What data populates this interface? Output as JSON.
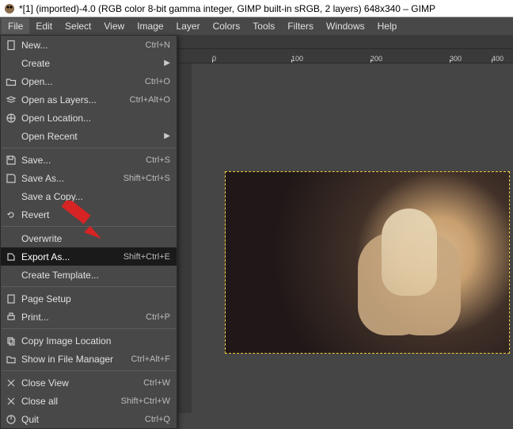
{
  "title": "*[1] (imported)-4.0 (RGB color 8-bit gamma integer, GIMP built-in sRGB, 2 layers) 648x340 – GIMP",
  "menubar": [
    "File",
    "Edit",
    "Select",
    "View",
    "Image",
    "Layer",
    "Colors",
    "Tools",
    "Filters",
    "Windows",
    "Help"
  ],
  "ruler_ticks": [
    "0",
    "100",
    "200",
    "300",
    "400"
  ],
  "file_menu": {
    "new": {
      "label": "New...",
      "accel": "Ctrl+N"
    },
    "create": {
      "label": "Create",
      "submenu": true
    },
    "open": {
      "label": "Open...",
      "accel": "Ctrl+O"
    },
    "open_layers": {
      "label": "Open as Layers...",
      "accel": "Ctrl+Alt+O"
    },
    "open_location": {
      "label": "Open Location..."
    },
    "open_recent": {
      "label": "Open Recent",
      "submenu": true
    },
    "save": {
      "label": "Save...",
      "accel": "Ctrl+S"
    },
    "save_as": {
      "label": "Save As...",
      "accel": "Shift+Ctrl+S"
    },
    "save_copy": {
      "label": "Save a Copy..."
    },
    "revert": {
      "label": "Revert"
    },
    "overwrite": {
      "label": "Overwrite"
    },
    "export_as": {
      "label": "Export As...",
      "accel": "Shift+Ctrl+E"
    },
    "create_template": {
      "label": "Create Template..."
    },
    "page_setup": {
      "label": "Page Setup"
    },
    "print": {
      "label": "Print...",
      "accel": "Ctrl+P"
    },
    "copy_loc": {
      "label": "Copy Image Location"
    },
    "show_fm": {
      "label": "Show in File Manager",
      "accel": "Ctrl+Alt+F"
    },
    "close_view": {
      "label": "Close View",
      "accel": "Ctrl+W"
    },
    "close_all": {
      "label": "Close all",
      "accel": "Shift+Ctrl+W"
    },
    "quit": {
      "label": "Quit",
      "accel": "Ctrl+Q"
    }
  }
}
